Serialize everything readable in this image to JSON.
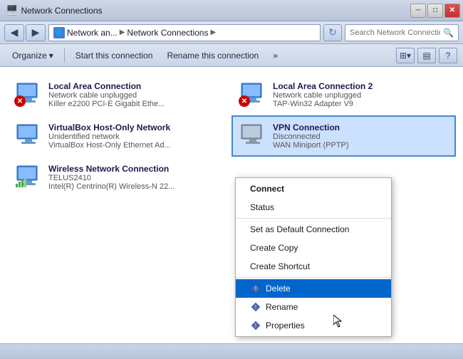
{
  "window": {
    "title": "Network Connections"
  },
  "title_bar": {
    "minimize_label": "─",
    "maximize_label": "□",
    "close_label": "✕"
  },
  "address_bar": {
    "breadcrumb_icon": "🌐",
    "breadcrumb_parts": [
      "Network an...",
      "Network Connections"
    ],
    "refresh_icon": "↻",
    "search_placeholder": "Search Network Connections"
  },
  "toolbar": {
    "organize_label": "Organize",
    "organize_arrow": "▾",
    "start_connection_label": "Start this connection",
    "rename_connection_label": "Rename this connection",
    "more_arrow": "»",
    "view_icon": "⊞",
    "panel_icon": "▤",
    "help_icon": "?"
  },
  "connections": [
    {
      "id": "local-area",
      "name": "Local Area Connection",
      "status": "Network cable unplugged",
      "detail": "Killer e2200 PCI-E Gigabit Ethe...",
      "has_error": true
    },
    {
      "id": "local-area-2",
      "name": "Local Area Connection 2",
      "status": "Network cable unplugged",
      "detail": "TAP-Win32 Adapter V9",
      "has_error": true
    },
    {
      "id": "virtualbox-host",
      "name": "VirtualBox Host-Only Network",
      "status": "Unidentified network",
      "detail": "VirtualBox Host-Only Ethernet Ad...",
      "has_error": false
    },
    {
      "id": "vpn-connection",
      "name": "VPN Connection",
      "status": "Disconnected",
      "detail": "WAN Miniport (PPTP)",
      "has_error": false,
      "selected": true
    },
    {
      "id": "wireless",
      "name": "Wireless Network Connection",
      "status": "TELUS2410",
      "detail": "Intel(R) Centrino(R) Wireless-N 22...",
      "has_error": false
    }
  ],
  "context_menu": {
    "items": [
      {
        "id": "connect",
        "label": "Connect",
        "bold": true,
        "icon": null,
        "separator_after": false
      },
      {
        "id": "status",
        "label": "Status",
        "bold": false,
        "icon": null,
        "separator_after": true
      },
      {
        "id": "set-default",
        "label": "Set as Default Connection",
        "bold": false,
        "icon": null,
        "separator_after": false
      },
      {
        "id": "create-copy",
        "label": "Create Copy",
        "bold": false,
        "icon": null,
        "separator_after": false
      },
      {
        "id": "create-shortcut",
        "label": "Create Shortcut",
        "bold": false,
        "icon": null,
        "separator_after": true
      },
      {
        "id": "delete",
        "label": "Delete",
        "bold": false,
        "icon": "shield",
        "separator_after": false,
        "highlighted": true
      },
      {
        "id": "rename",
        "label": "Rename",
        "bold": false,
        "icon": "shield",
        "separator_after": false
      },
      {
        "id": "properties",
        "label": "Properties",
        "bold": false,
        "icon": "shield",
        "separator_after": false
      }
    ]
  },
  "status_bar": {
    "text": ""
  }
}
